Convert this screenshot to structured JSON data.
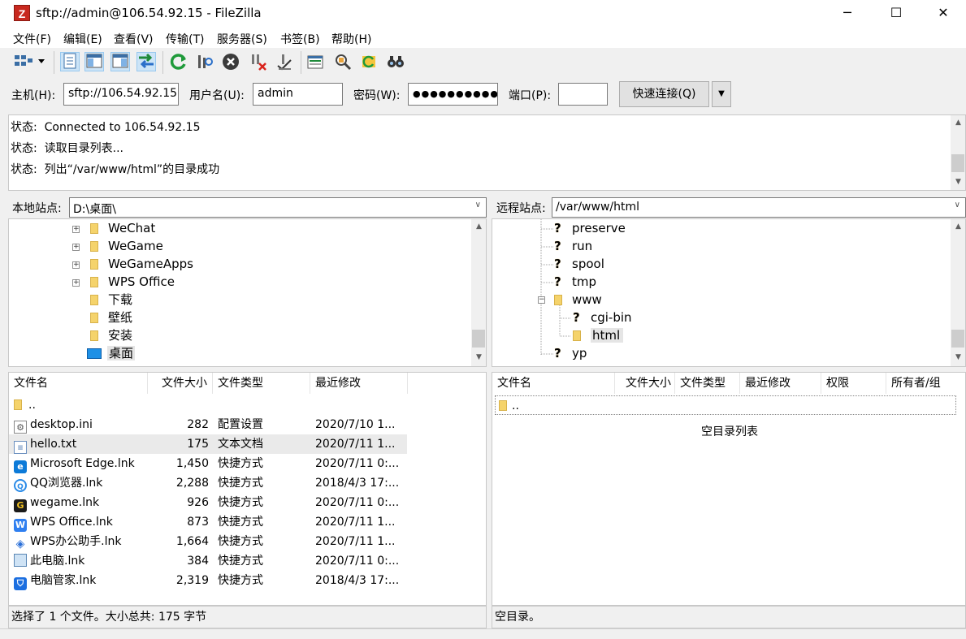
{
  "window": {
    "title": "sftp://admin@106.54.92.15 - FileZilla",
    "app_icon": "Z",
    "minimize": "─",
    "maximize": "☐",
    "close": "✕"
  },
  "menu": [
    "文件(F)",
    "编辑(E)",
    "查看(V)",
    "传输(T)",
    "服务器(S)",
    "书签(B)",
    "帮助(H)"
  ],
  "toolbar": {
    "icons": [
      "site-manager-icon",
      "toggle-log-icon",
      "toggle-local-tree-icon",
      "toggle-remote-tree-icon",
      "toggle-queue-icon",
      "refresh-icon",
      "process-queue-icon",
      "cancel-icon",
      "disconnect-icon",
      "reconnect-icon",
      "filter-icon",
      "compare-icon",
      "sync-browse-icon",
      "search-icon"
    ]
  },
  "quickconnect": {
    "host_label": "主机(H):",
    "host_value": "sftp://106.54.92.15",
    "user_label": "用户名(U):",
    "user_value": "admin",
    "pass_label": "密码(W):",
    "pass_value": "●●●●●●●●●●",
    "port_label": "端口(P):",
    "port_value": "",
    "button": "快速连接(Q)",
    "dropdown": "▼"
  },
  "log": [
    {
      "label": "状态:",
      "text": "Connected to 106.54.92.15"
    },
    {
      "label": "状态:",
      "text": "读取目录列表..."
    },
    {
      "label": "状态:",
      "text": "列出“/var/www/html”的目录成功"
    }
  ],
  "local": {
    "site_label": "本地站点:",
    "path": "D:\\桌面\\",
    "tree": [
      "WeChat",
      "WeGame",
      "WeGameApps",
      "WPS Office",
      "下载",
      "壁纸",
      "安装",
      "桌面"
    ],
    "columns": [
      "文件名",
      "文件大小",
      "文件类型",
      "最近修改"
    ],
    "files": [
      {
        "name": "..",
        "size": "",
        "type": "",
        "modified": ""
      },
      {
        "name": "desktop.ini",
        "size": "282",
        "type": "配置设置",
        "modified": "2020/7/10 1..."
      },
      {
        "name": "hello.txt",
        "size": "175",
        "type": "文本文档",
        "modified": "2020/7/11 1..."
      },
      {
        "name": "Microsoft Edge.lnk",
        "size": "1,450",
        "type": "快捷方式",
        "modified": "2020/7/11 0:..."
      },
      {
        "name": "QQ浏览器.lnk",
        "size": "2,288",
        "type": "快捷方式",
        "modified": "2018/4/3 17:..."
      },
      {
        "name": "wegame.lnk",
        "size": "926",
        "type": "快捷方式",
        "modified": "2020/7/11 0:..."
      },
      {
        "name": "WPS Office.lnk",
        "size": "873",
        "type": "快捷方式",
        "modified": "2020/7/11 1..."
      },
      {
        "name": "WPS办公助手.lnk",
        "size": "1,664",
        "type": "快捷方式",
        "modified": "2020/7/11 1..."
      },
      {
        "name": "此电脑.lnk",
        "size": "384",
        "type": "快捷方式",
        "modified": "2020/7/11 0:..."
      },
      {
        "name": "电脑管家.lnk",
        "size": "2,319",
        "type": "快捷方式",
        "modified": "2018/4/3 17:..."
      }
    ],
    "status": "选择了 1 个文件。大小总共: 175 字节"
  },
  "remote": {
    "site_label": "远程站点:",
    "path": "/var/www/html",
    "tree": [
      "preserve",
      "run",
      "spool",
      "tmp",
      "www",
      "cgi-bin",
      "html",
      "yp"
    ],
    "columns": [
      "文件名",
      "文件大小",
      "文件类型",
      "最近修改",
      "权限",
      "所有者/组"
    ],
    "files": [
      {
        "name": ".."
      }
    ],
    "empty_text": "空目录列表",
    "status": "空目录。"
  }
}
